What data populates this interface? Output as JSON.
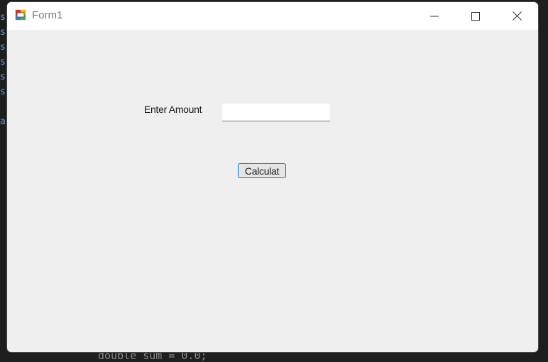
{
  "window": {
    "title": "Form1",
    "minimize_label": "Minimize",
    "maximize_label": "Maximize",
    "close_label": "Close"
  },
  "form": {
    "amount_label": "Enter Amount",
    "amount_value": "",
    "calculate_button": "Calculat"
  },
  "background": {
    "code_line": "double sum = 0.0;"
  },
  "colors": {
    "titlebar": "#ffffff",
    "form_background": "#efefef",
    "button_focus_border": "#0078d7"
  }
}
